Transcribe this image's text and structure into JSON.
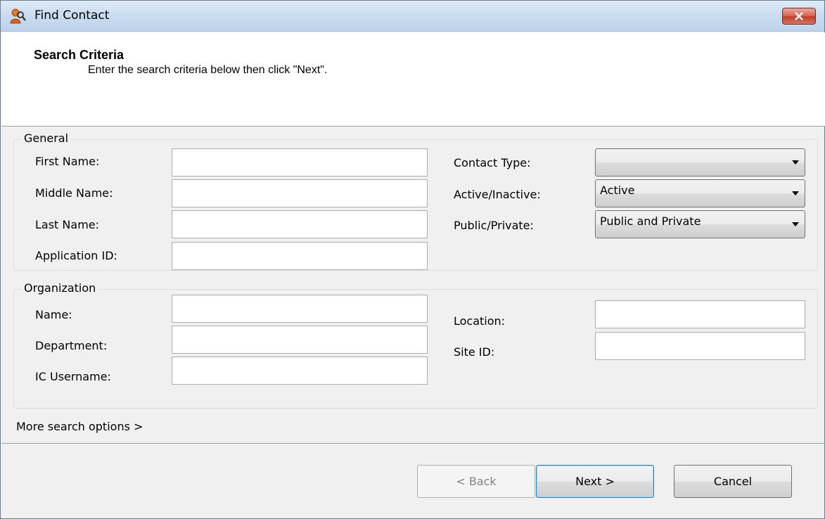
{
  "window": {
    "title": "Find Contact",
    "icon": "contact-search-icon",
    "close_icon": "close-icon"
  },
  "header": {
    "title": "Search Criteria",
    "subtitle": "Enter the search criteria below then click \"Next\"."
  },
  "general": {
    "group_label": "General",
    "first_name": {
      "label": "First Name:",
      "value": ""
    },
    "middle_name": {
      "label": "Middle Name:",
      "value": ""
    },
    "last_name": {
      "label": "Last Name:",
      "value": ""
    },
    "application_id": {
      "label": "Application ID:",
      "value": ""
    },
    "contact_type": {
      "label": "Contact Type:",
      "value": ""
    },
    "active_inactive": {
      "label": "Active/Inactive:",
      "value": "Active"
    },
    "public_private": {
      "label": "Public/Private:",
      "value": "Public and Private"
    }
  },
  "organization": {
    "group_label": "Organization",
    "name": {
      "label": "Name:",
      "value": ""
    },
    "department": {
      "label": "Department:",
      "value": ""
    },
    "ic_username": {
      "label": "IC Username:",
      "value": ""
    },
    "location": {
      "label": "Location:",
      "value": ""
    },
    "site_id": {
      "label": "Site ID:",
      "value": ""
    }
  },
  "more_options": "More search options >",
  "buttons": {
    "back": "< Back",
    "next": "Next >",
    "cancel": "Cancel"
  },
  "colors": {
    "title_bar": "#c9dcf0",
    "close_button": "#c23a24",
    "dialog_background": "#f0f0f0",
    "default_button_border": "#3c7fb1"
  }
}
